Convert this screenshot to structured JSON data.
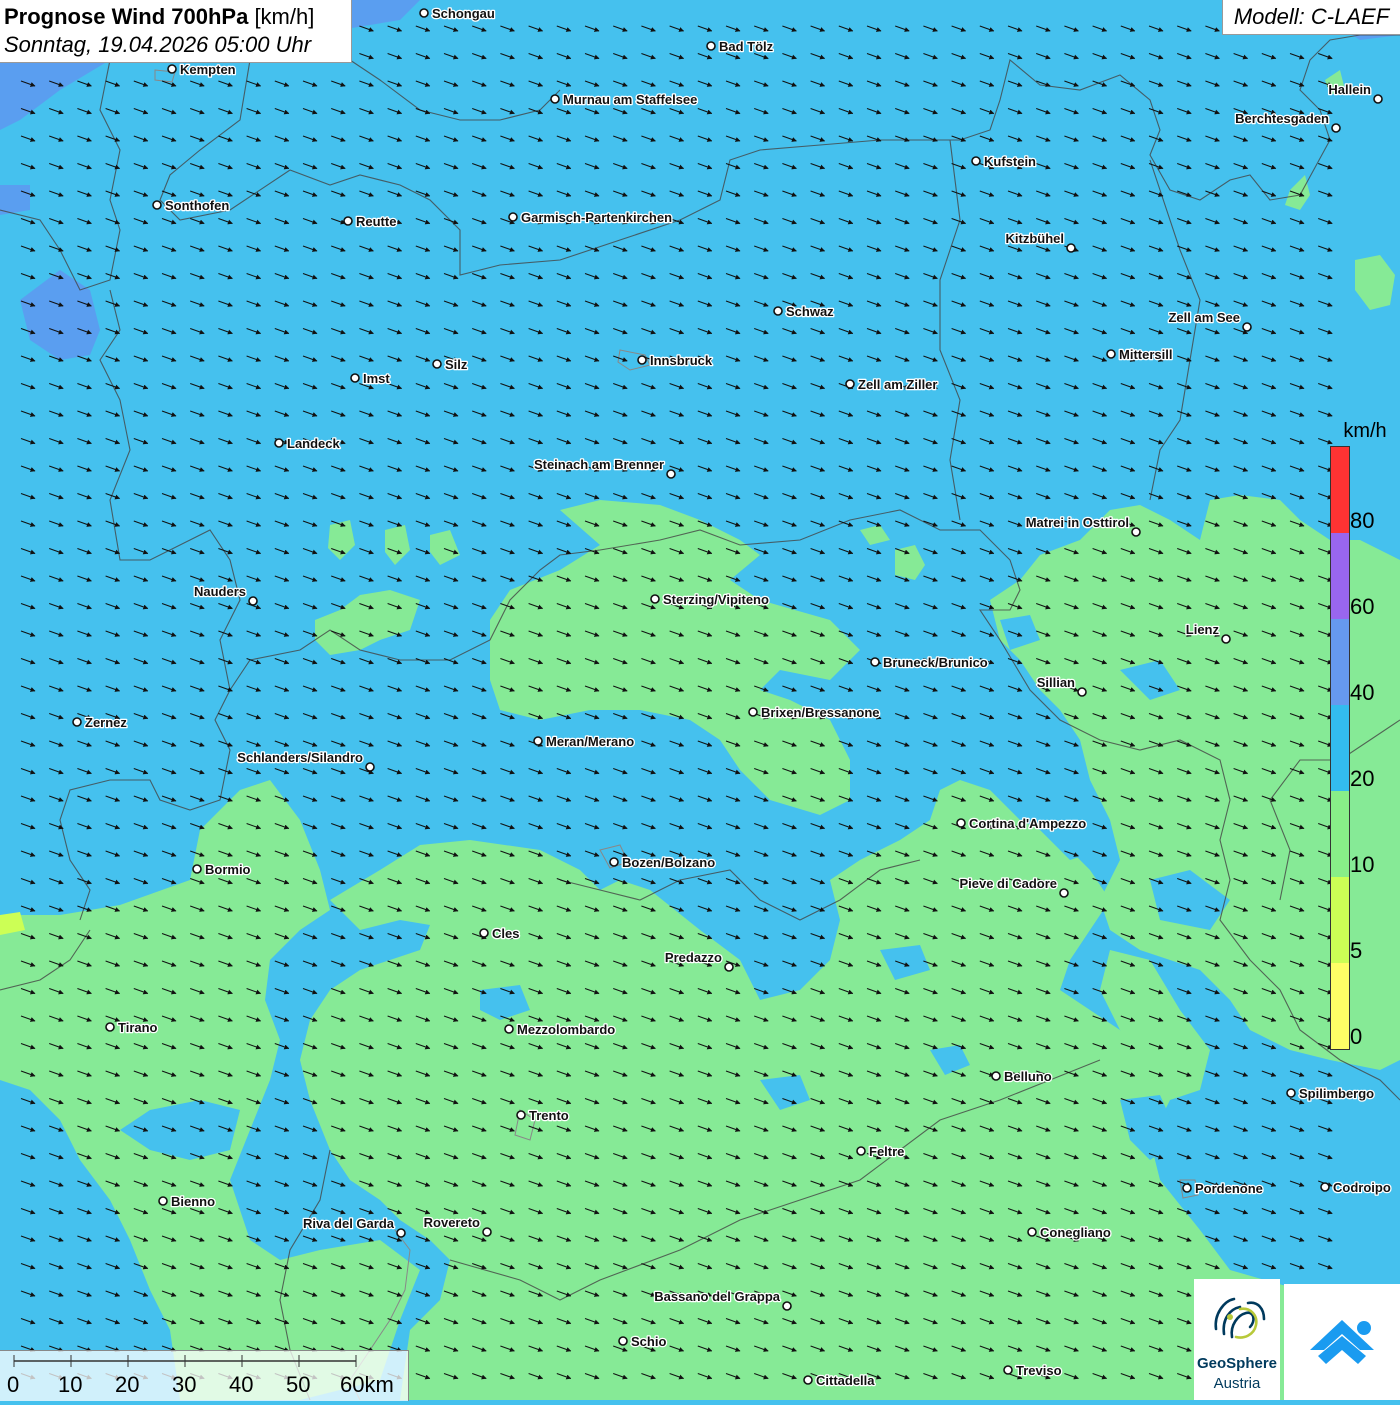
{
  "header": {
    "title_bold": "Prognose Wind 700hPa",
    "title_unit": "[km/h]",
    "datetime": "Sonntag, 19.04.2026 05:00 Uhr",
    "model": "Modell: C-LAEF"
  },
  "legend": {
    "unit": "km/h",
    "labels": [
      "80",
      "60",
      "40",
      "20",
      "10",
      "5",
      "0"
    ],
    "colors": [
      "#ff3333",
      "#9966ee",
      "#6699ee",
      "#33bbee",
      "#88ee88",
      "#ccff55",
      "#ffff66"
    ]
  },
  "scalebar": {
    "labels": [
      "0",
      "10",
      "20",
      "30",
      "40",
      "50",
      "60km"
    ]
  },
  "logos": {
    "geosphere_line1": "GeoSphere",
    "geosphere_line2": "Austria"
  },
  "colors": {
    "wind_10_20": "#86ea96",
    "wind_20_40": "#45c1ee",
    "wind_40_60": "#5a9ef0",
    "arrow": "#111111",
    "border": "#555555"
  },
  "cities": [
    {
      "name": "Schongau",
      "label_side": "right"
    },
    {
      "name": "Bad Tölz",
      "label_side": "right"
    },
    {
      "name": "Kempten",
      "label_side": "right"
    },
    {
      "name": "Murnau am Staffelsee",
      "label_side": "right"
    },
    {
      "name": "Hallein",
      "label_side": "left"
    },
    {
      "name": "Berchtesgaden",
      "label_side": "left"
    },
    {
      "name": "Kufstein",
      "label_side": "right"
    },
    {
      "name": "Sonthofen",
      "label_side": "right"
    },
    {
      "name": "Reutte",
      "label_side": "right"
    },
    {
      "name": "Garmisch-Partenkirchen",
      "label_side": "right"
    },
    {
      "name": "Kitzbühel",
      "label_side": "left"
    },
    {
      "name": "Schwaz",
      "label_side": "right"
    },
    {
      "name": "Zell am See",
      "label_side": "left"
    },
    {
      "name": "Mittersill",
      "label_side": "right"
    },
    {
      "name": "Innsbruck",
      "label_side": "right"
    },
    {
      "name": "Silz",
      "label_side": "right"
    },
    {
      "name": "Imst",
      "label_side": "right"
    },
    {
      "name": "Zell am Ziller",
      "label_side": "right"
    },
    {
      "name": "Landeck",
      "label_side": "right"
    },
    {
      "name": "Steinach am Brenner",
      "label_side": "left"
    },
    {
      "name": "Matrei in Osttirol",
      "label_side": "left"
    },
    {
      "name": "Nauders",
      "label_side": "left"
    },
    {
      "name": "Sterzing/Vipiteno",
      "label_side": "right"
    },
    {
      "name": "Lienz",
      "label_side": "left"
    },
    {
      "name": "Bruneck/Brunico",
      "label_side": "right"
    },
    {
      "name": "Sillian",
      "label_side": "left"
    },
    {
      "name": "Brixen/Bressanone",
      "label_side": "right"
    },
    {
      "name": "Zernez",
      "label_side": "right"
    },
    {
      "name": "Meran/Merano",
      "label_side": "right"
    },
    {
      "name": "Schlanders/Silandro",
      "label_side": "left"
    },
    {
      "name": "Cortina d'Ampezzo",
      "label_side": "right"
    },
    {
      "name": "Bormio",
      "label_side": "right"
    },
    {
      "name": "Bozen/Bolzano",
      "label_side": "right"
    },
    {
      "name": "Pieve di Cadore",
      "label_side": "left"
    },
    {
      "name": "Cles",
      "label_side": "right"
    },
    {
      "name": "Predazzo",
      "label_side": "left"
    },
    {
      "name": "Tirano",
      "label_side": "right"
    },
    {
      "name": "Mezzolombardo",
      "label_side": "right"
    },
    {
      "name": "Belluno",
      "label_side": "right"
    },
    {
      "name": "Spilimbergo",
      "label_side": "right"
    },
    {
      "name": "Trento",
      "label_side": "right"
    },
    {
      "name": "Feltre",
      "label_side": "right"
    },
    {
      "name": "Pordenone",
      "label_side": "right"
    },
    {
      "name": "Codroipo",
      "label_side": "right"
    },
    {
      "name": "Bienno",
      "label_side": "right"
    },
    {
      "name": "Riva del Garda",
      "label_side": "left"
    },
    {
      "name": "Rovereto",
      "label_side": "left"
    },
    {
      "name": "Conegliano",
      "label_side": "right"
    },
    {
      "name": "Bassano del Grappa",
      "label_side": "left"
    },
    {
      "name": "Schio",
      "label_side": "right"
    },
    {
      "name": "Treviso",
      "label_side": "right"
    },
    {
      "name": "Cittadella",
      "label_side": "right"
    }
  ]
}
